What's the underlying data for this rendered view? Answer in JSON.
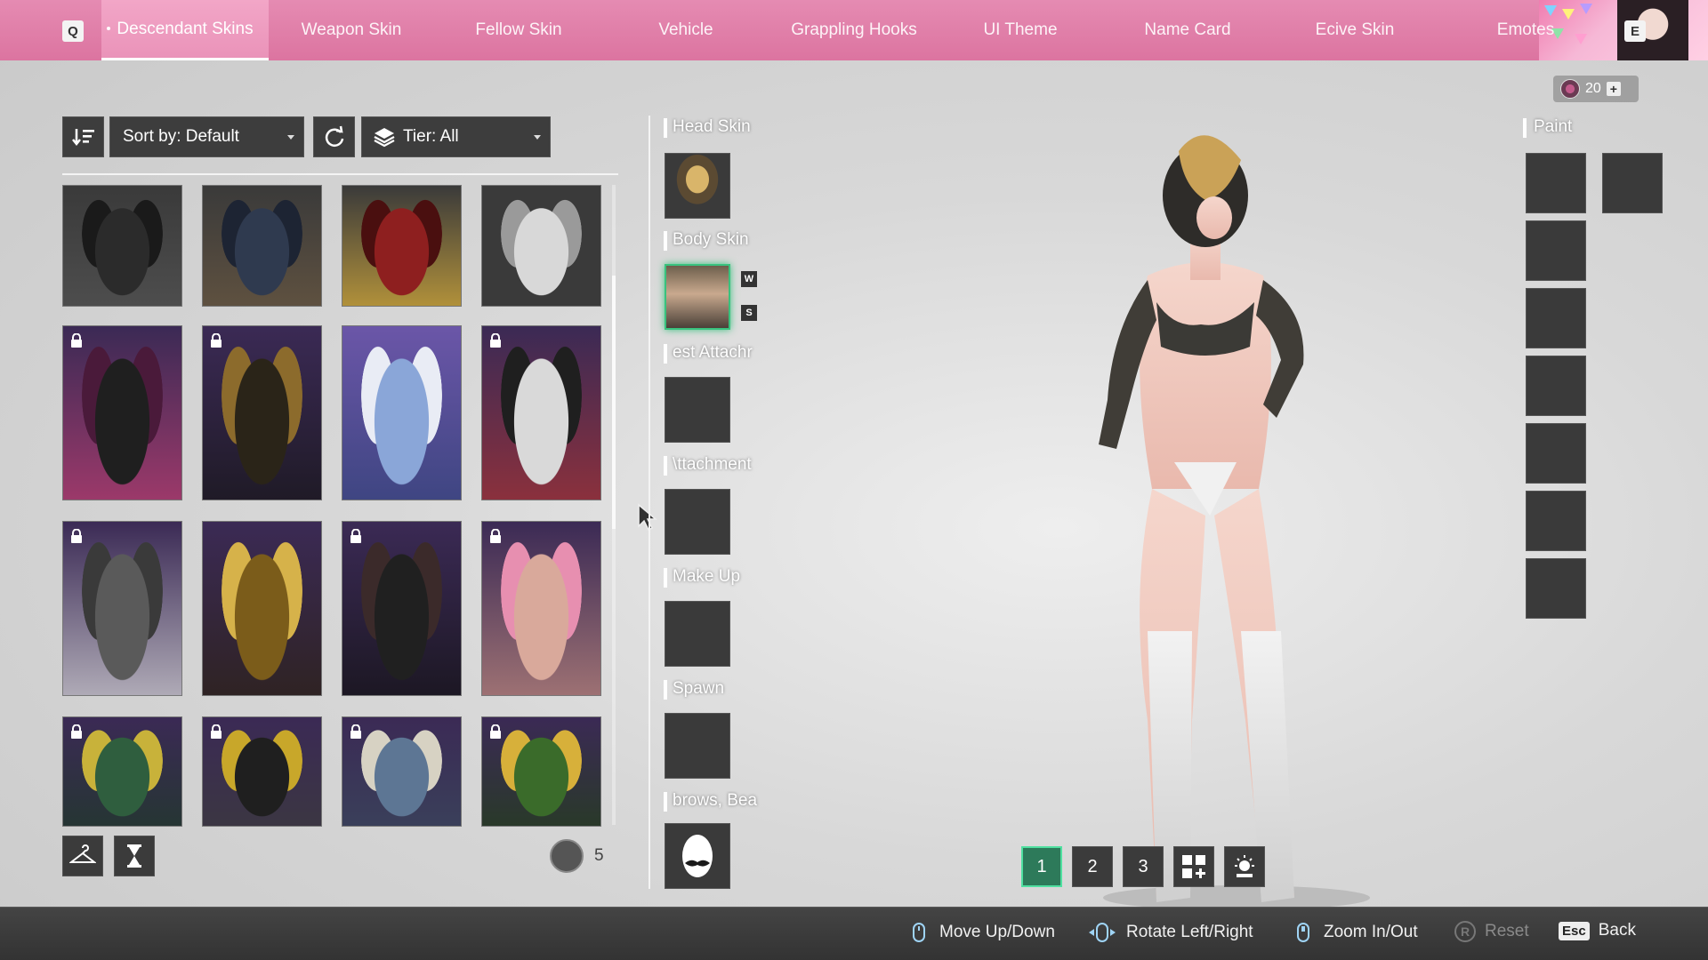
{
  "nav": {
    "prev_key": "Q",
    "next_key": "E",
    "tabs": [
      {
        "label": "Descendant Skins",
        "active": true
      },
      {
        "label": "Weapon Skin"
      },
      {
        "label": "Fellow Skin"
      },
      {
        "label": "Vehicle"
      },
      {
        "label": "Grappling Hooks"
      },
      {
        "label": "UI Theme"
      },
      {
        "label": "Name Card"
      },
      {
        "label": "Ecive Skin"
      },
      {
        "label": "Emotes"
      }
    ]
  },
  "currency": {
    "amount": "20",
    "icon": "coin-icon",
    "add_icon": "plus-icon"
  },
  "toolbar": {
    "sort_label": "Sort by: Default",
    "tier_label": "Tier: All",
    "order_icon": "sort-order-icon",
    "reset_icon": "refresh-icon",
    "tier_icon": "layers-icon"
  },
  "skins": [
    {
      "row": 0,
      "locked": false,
      "palette": "black-dress"
    },
    {
      "row": 0,
      "locked": false,
      "palette": "denim"
    },
    {
      "row": 0,
      "locked": false,
      "palette": "red-racer"
    },
    {
      "row": 0,
      "locked": false,
      "palette": "white-suit"
    },
    {
      "row": 1,
      "locked": true,
      "palette": "black-jacket"
    },
    {
      "row": 1,
      "locked": true,
      "palette": "gold-black"
    },
    {
      "row": 1,
      "locked": false,
      "palette": "blue-armor"
    },
    {
      "row": 1,
      "locked": true,
      "palette": "school-uniform"
    },
    {
      "row": 2,
      "locked": true,
      "palette": "grey-blazer"
    },
    {
      "row": 2,
      "locked": false,
      "palette": "gold-armor"
    },
    {
      "row": 2,
      "locked": true,
      "palette": "black-mesh"
    },
    {
      "row": 2,
      "locked": true,
      "palette": "pink-swim"
    },
    {
      "row": 3,
      "locked": true,
      "palette": "green-suit"
    },
    {
      "row": 3,
      "locked": true,
      "palette": "yellow-black"
    },
    {
      "row": 3,
      "locked": true,
      "palette": "overalls"
    },
    {
      "row": 3,
      "locked": true,
      "palette": "corn"
    }
  ],
  "inventory": {
    "box_count": "5",
    "box_icon": "storage-box-icon"
  },
  "bottom_buttons": {
    "hanger_icon": "hanger-icon",
    "hourglass_icon": "hourglass-icon"
  },
  "slots": [
    {
      "label": "Head Skin",
      "filled": true
    },
    {
      "label": "Body Skin",
      "filled": true,
      "equipped": true,
      "keys": [
        "W",
        "S"
      ]
    },
    {
      "label": "est Attachr",
      "filled": false
    },
    {
      "label": "\\ttachment",
      "filled": false
    },
    {
      "label": "Make Up",
      "filled": false
    },
    {
      "label": "Spawn",
      "filled": false
    },
    {
      "label": "brows, Bea",
      "filled": true
    }
  ],
  "paint": {
    "label": "Paint"
  },
  "presets": [
    {
      "label": "1",
      "active": true
    },
    {
      "label": "2"
    },
    {
      "label": "3"
    },
    {
      "icon": "add-preset-icon"
    },
    {
      "icon": "lighting-icon"
    }
  ],
  "hints": [
    {
      "label": "Move Up/Down",
      "icon": "mouse-wheel-icon"
    },
    {
      "label": "Rotate Left/Right",
      "icon": "mouse-drag-icon"
    },
    {
      "label": "Zoom In/Out",
      "icon": "mouse-scroll-icon"
    },
    {
      "label": "Reset",
      "key": "R",
      "disabled": true
    },
    {
      "label": "Back",
      "key": "Esc"
    }
  ]
}
